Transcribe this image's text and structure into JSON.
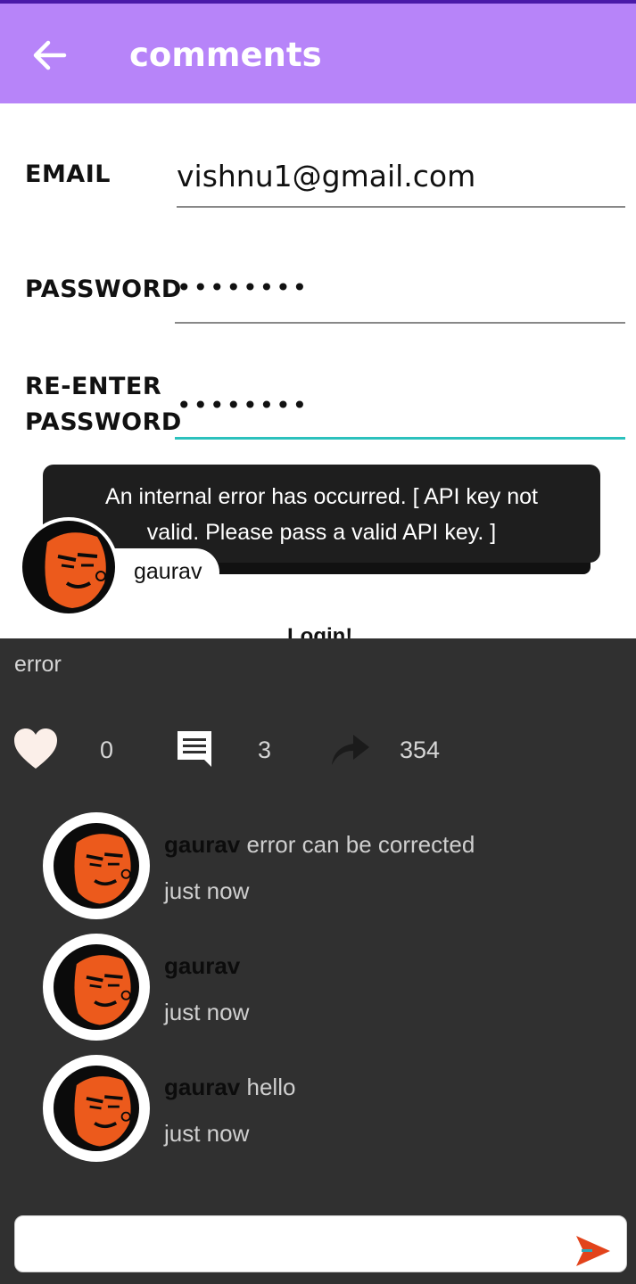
{
  "appbar": {
    "title": "comments",
    "back_icon": "arrow-left-icon"
  },
  "form": {
    "email_label": "EMAIL",
    "email_value": "vishnu1@gmail.com",
    "password_label": "PASSWORD",
    "password_value": "••••••••",
    "reenter_label_line1": "RE-ENTER",
    "reenter_label_line2": "PASSWORD",
    "reenter_value": "••••••••",
    "login_label": "Login!"
  },
  "toast": {
    "line1": "An internal error has occurred. [ API key not",
    "line2": "valid. Please pass a valid API key. ]"
  },
  "post": {
    "author": "gaurav",
    "text": "error",
    "likes": "0",
    "comments": "3",
    "shares": "354"
  },
  "comments": [
    {
      "user": "gaurav",
      "text": "error can be corrected",
      "time": "just now"
    },
    {
      "user": "gaurav",
      "text": "",
      "time": "just now"
    },
    {
      "user": "gaurav",
      "text": "hello",
      "time": "just now"
    }
  ],
  "comment_input": {
    "value": "",
    "placeholder": ""
  },
  "colors": {
    "appbar": "#b784f9",
    "dark_bg": "#303030",
    "focus_underline": "#2cc1bd",
    "send_icon": "#e2431b"
  }
}
